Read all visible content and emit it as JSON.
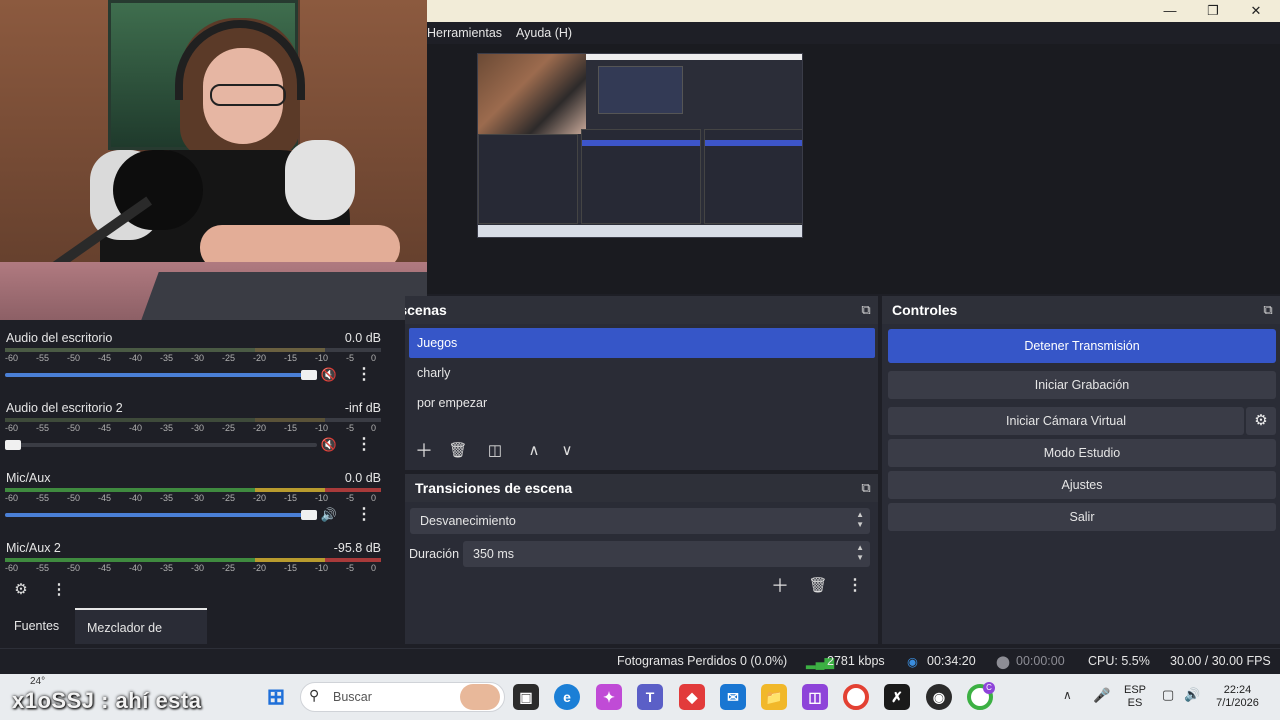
{
  "window": {
    "minimize_icon": "minimize-icon",
    "maximize_icon": "restore-icon",
    "close_icon": "close-icon"
  },
  "menu": {
    "items": [
      "Herramientas",
      "Ayuda (H)"
    ]
  },
  "audio_mixer": {
    "channels": [
      {
        "name": "Audio del escritorio",
        "db": "0.0 dB",
        "volume": 0.97,
        "muted": true
      },
      {
        "name": "Audio del escritorio 2",
        "db": "-inf dB",
        "volume": 0.0,
        "muted": true
      },
      {
        "name": "Mic/Aux",
        "db": "0.0 dB",
        "volume": 0.97,
        "muted": false
      },
      {
        "name": "Mic/Aux 2",
        "db": "-95.8 dB",
        "volume": 0.0,
        "muted": false
      }
    ],
    "ticks": [
      "-60",
      "-55",
      "-50",
      "-45",
      "-40",
      "-35",
      "-30",
      "-25",
      "-20",
      "-15",
      "-10",
      "-5",
      "0"
    ]
  },
  "dock_tabs": {
    "sources": "Fuentes",
    "mixer": "Mezclador de audio"
  },
  "scenes": {
    "title": "Escenas",
    "items": [
      "Juegos",
      "charly",
      "por empezar"
    ],
    "selected": "Juegos"
  },
  "transitions": {
    "title": "Transiciones de escena",
    "selected": "Desvanecimiento",
    "duration_label": "Duración",
    "duration_value": "350 ms"
  },
  "controls": {
    "title": "Controles",
    "stop_stream": "Detener Transmisión",
    "start_recording": "Iniciar Grabación",
    "start_virtual_cam": "Iniciar Cámara Virtual",
    "studio_mode": "Modo Estudio",
    "settings": "Ajustes",
    "exit": "Salir"
  },
  "status": {
    "dropped_frames": "Fotogramas Perdidos 0 (0.0%)",
    "bitrate": "2781 kbps",
    "stream_time": "00:34:20",
    "record_time": "00:00:00",
    "cpu": "CPU: 5.5%",
    "fps": "30.00 / 30.00 FPS",
    "colors": {
      "live": "#3a8dde",
      "signal": "#3cb043"
    }
  },
  "taskbar": {
    "weather_temp": "24°",
    "overlay_chat": "x1oSSJ : ahí esta",
    "search_placeholder": "Buscar",
    "lang_top": "ESP",
    "lang_bottom": "ES",
    "time": "22:24",
    "date": "7/1/2026",
    "notification_badge": "C"
  }
}
